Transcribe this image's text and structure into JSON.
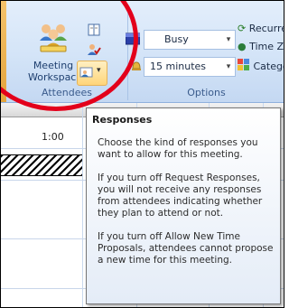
{
  "ribbon": {
    "attendees": {
      "meeting_workspace_label": "Meeting Workspace",
      "group_label": "Attendees",
      "icons": [
        "meeting-workspace-icon",
        "address-book-icon",
        "check-names-icon",
        "responses-icon"
      ]
    },
    "options": {
      "show_as_value": "Busy",
      "reminder_value": "15 minutes",
      "recurrence_label": "Recurre",
      "time_zones_label": "Time Z",
      "categorize_label": "Catego",
      "group_label": "Options"
    }
  },
  "calendar": {
    "time_label": "1:00"
  },
  "tooltip": {
    "title": "Responses",
    "paragraphs": [
      "Choose the kind of responses you want to allow for this meeting.",
      "If you turn off Request Responses, you will not receive any responses from attendees indicating whether they plan to attend or not.",
      "If you turn off Allow New Time Proposals, attendees cannot propose a new time for this meeting."
    ]
  },
  "colors": {
    "annotation_circle": "#e3001b",
    "ribbon_bg": "#d5e5f8",
    "busy_color": "#2b3fa8"
  }
}
